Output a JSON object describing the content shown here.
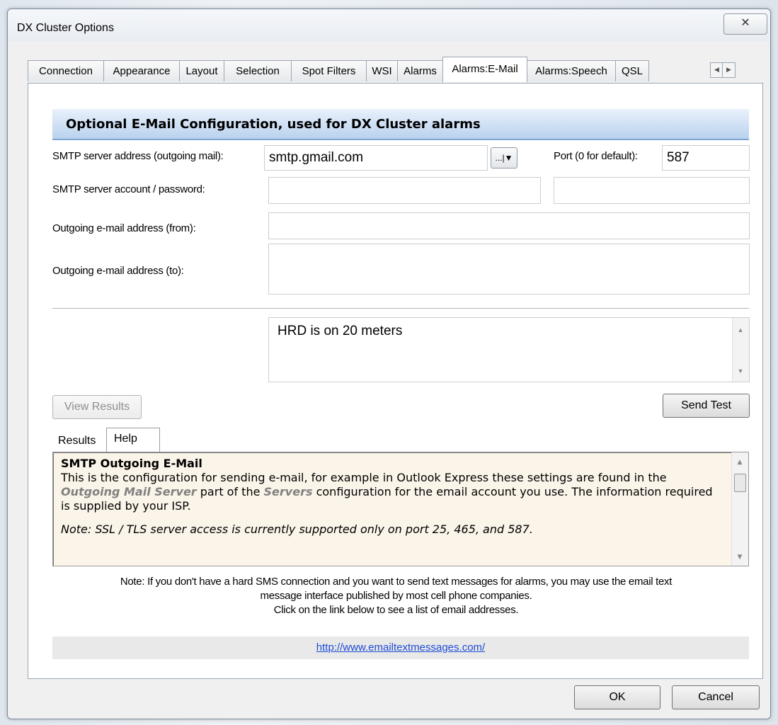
{
  "window": {
    "title": "DX Cluster Options",
    "close_glyph": "✕"
  },
  "tabs": [
    "Connection",
    "Appearance",
    "Layout",
    "Selection",
    "Spot Filters",
    "WSI",
    "Alarms",
    "Alarms:E-Mail",
    "Alarms:Speech",
    "QSL"
  ],
  "active_tab": "Alarms:E-Mail",
  "header": "Optional E-Mail Configuration, used for DX Cluster alarms",
  "form": {
    "smtp_label": "SMTP server address (outgoing mail):",
    "smtp_value": "smtp.gmail.com",
    "smtp_browse": "...",
    "port_label": "Port (0 for default):",
    "port_value": "587",
    "account_label": "SMTP server account / password:",
    "account_value": "",
    "password_value": "",
    "from_label": "Outgoing e-mail address (from):",
    "from_value": "",
    "to_label": "Outgoing e-mail address (to):",
    "to_value": ""
  },
  "message_text": "HRD is on 20 meters",
  "buttons": {
    "view_results": "View Results",
    "send_test": "Send Test",
    "ok": "OK",
    "cancel": "Cancel"
  },
  "subtabs": [
    "Results",
    "Help"
  ],
  "help": {
    "title": "SMTP Outgoing E-Mail",
    "p1_a": "This is the configuration for sending e-mail, for example in Outlook Express these settings are found in the ",
    "p1_em1": "Outgoing Mail Server",
    "p1_b": " part of the ",
    "p1_em2": "Servers",
    "p1_c": " configuration for the email account you use. The information required is supplied by your ISP.",
    "note": "Note: SSL / TLS server access is currently supported only on port 25, 465, and 587."
  },
  "note": {
    "line1": "Note: If you don't have a hard SMS connection and you want to send text messages for alarms, you may use the email text",
    "line2": "message interface published by most cell phone companies.",
    "line3": "Click on the link below to see a list of email addresses."
  },
  "link": "http://www.emailtextmessages.com/"
}
